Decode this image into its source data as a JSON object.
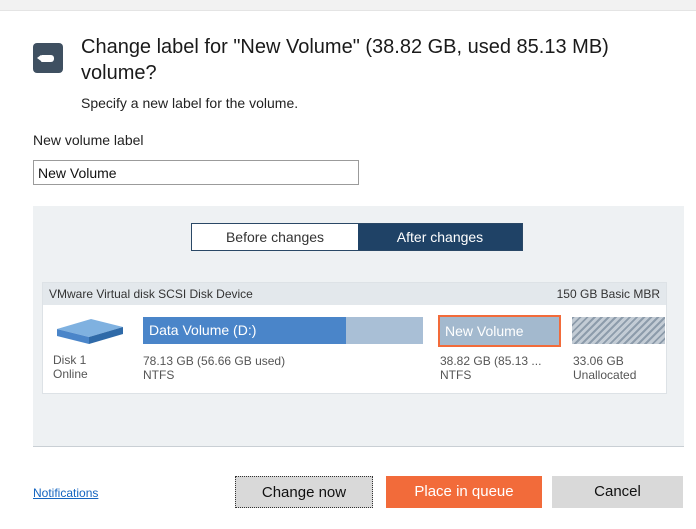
{
  "dialog": {
    "title": "Change label for \"New Volume\" (38.82 GB, used 85.13 MB) volume?",
    "subtitle": "Specify a new label for the volume.",
    "field_label": "New volume label",
    "field_value": "New Volume",
    "icon": "tag-icon"
  },
  "toggle": {
    "before_label": "Before changes",
    "after_label": "After changes",
    "selected": "After changes"
  },
  "disk": {
    "device": "VMware Virtual disk SCSI Disk Device",
    "info": "150 GB Basic MBR",
    "number": "Disk 1",
    "status": "Online",
    "volumes": [
      {
        "name": "Data Volume (D:)",
        "size": "78.13 GB (56.66 GB used)",
        "fs": "NTFS",
        "used_fraction": 0.725
      },
      {
        "name": "New Volume",
        "size": "38.82 GB (85.13 ...",
        "fs": "NTFS"
      },
      {
        "name": "",
        "size": "33.06 GB",
        "fs": "Unallocated"
      }
    ]
  },
  "footer": {
    "notifications": "Notifications",
    "change_now": "Change now",
    "place_in_queue": "Place in queue",
    "cancel": "Cancel"
  },
  "colors": {
    "accent": "#f26b3a",
    "toggle_active": "#1f4266",
    "volume_blue": "#4a85c9"
  }
}
